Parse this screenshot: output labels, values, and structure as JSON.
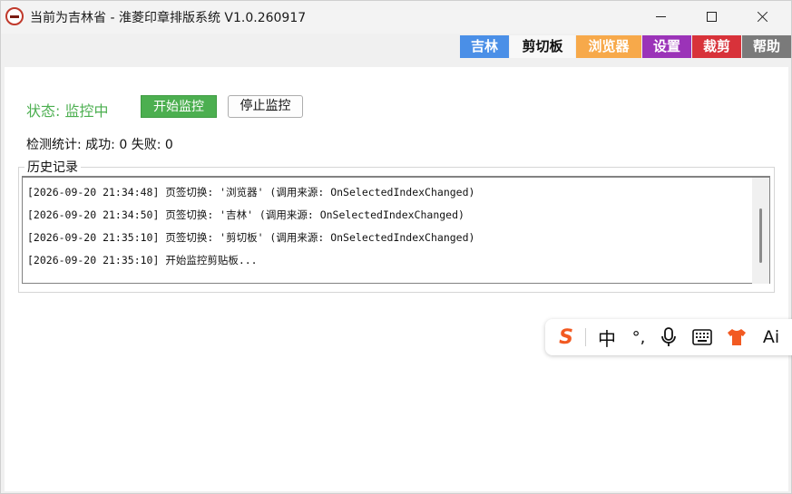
{
  "window": {
    "title": "当前为吉林省 - 淮菱印章排版系统 V1.0.260917"
  },
  "tabs": [
    {
      "label": "吉林"
    },
    {
      "label": "剪切板"
    },
    {
      "label": "浏览器"
    },
    {
      "label": "设置"
    },
    {
      "label": "裁剪"
    },
    {
      "label": "帮助"
    }
  ],
  "monitor": {
    "status_text": "状态: 监控中",
    "start_label": "开始监控",
    "stop_label": "停止监控",
    "stats_text": "检测统计: 成功: 0  失败: 0"
  },
  "history": {
    "title": "历史记录",
    "entries": [
      "[2026-09-20 21:34:48] 页签切换: '浏览器' (调用来源: OnSelectedIndexChanged)",
      "[2026-09-20 21:34:50] 页签切换: '吉林' (调用来源: OnSelectedIndexChanged)",
      "[2026-09-20 21:35:10] 页签切换: '剪切板' (调用来源: OnSelectedIndexChanged)",
      "[2026-09-20 21:35:10] 开始监控剪贴板..."
    ]
  },
  "ime": {
    "logo": "S",
    "mode": "中",
    "punct": "°,",
    "ai": "Ai"
  },
  "colors": {
    "tab_jilin": "#4a8fe7",
    "tab_browser": "#f7a94a",
    "tab_settings": "#9b33b8",
    "tab_crop": "#d8323a",
    "tab_help": "#7a7a7a",
    "status_green": "#4caf50",
    "ime_brand": "#f25a22"
  }
}
